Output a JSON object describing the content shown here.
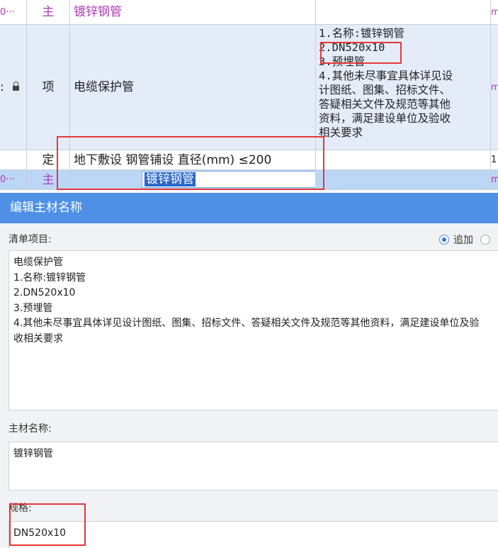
{
  "grid": {
    "rows": [
      {
        "c0": "0···",
        "c1": "主",
        "c2": "镀锌钢管",
        "c3": "",
        "c4": "m"
      },
      {
        "c0": ":",
        "c1": "项",
        "c2": "电缆保护管",
        "c3_lines": [
          "1.名称:镀锌钢管",
          "2.DN520x10",
          "3.预埋管",
          "4.其他未尽事宜具体详见设",
          "计图纸、图集、招标文件、",
          "答疑相关文件及规范等其他",
          "资料，满足建设单位及验收",
          "相关要求"
        ],
        "c4": "m"
      },
      {
        "c0": "",
        "c1": "定",
        "c2": "地下敷设 钢管铺设 直径(mm) ≤200",
        "c3": "",
        "c4": "1"
      },
      {
        "c0": "0···",
        "c1": "主",
        "c2": "镀锌钢管",
        "c3": "",
        "c4": "m"
      }
    ],
    "edit_button": "···",
    "lock_icon": "lock-icon"
  },
  "dialog": {
    "title": "编辑主材名称",
    "list_item_label": "清单项目:",
    "radio_append": "追加",
    "list_item_lines": [
      "电缆保护管",
      "1.名称:镀锌钢管",
      "2.DN520x10",
      "3.预埋管",
      "4.其他未尽事宜具体详见设计图纸、图集、招标文件、答疑相关文件及规范等其他资料，满足建设单位及验",
      "收相关要求"
    ],
    "material_name_label": "主材名称:",
    "material_name_value": "镀锌钢管",
    "spec_label": "规格:",
    "spec_value": "DN520x10"
  },
  "colors": {
    "title_bar": "#4d90e6",
    "selected_row": "#bcd6f6",
    "highlight_row": "#e4ecfa",
    "annotation": "#e53935",
    "material_text": "#b03bb8"
  }
}
